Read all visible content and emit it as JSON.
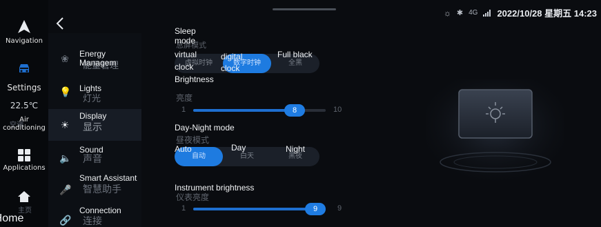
{
  "status_bar": {
    "bluetooth_icon": "bluetooth-icon",
    "signal": "4G",
    "datetime": "2022/10/28 星期五 14:23"
  },
  "rail": {
    "navigation": {
      "label": "Navigation",
      "icon": "navigation-arrow-icon"
    },
    "settings": {
      "label": "Settings",
      "icon": "car-settings-icon"
    },
    "temperature": "22.5℃",
    "climate": {
      "label": "Air conditioning",
      "zh": "空调"
    },
    "applications": {
      "label": "Applications",
      "icon": "apps-grid-icon"
    },
    "home": {
      "label": "Home",
      "zh": "主页",
      "icon": "home-icon"
    }
  },
  "menu": {
    "items": [
      {
        "en": "Energy Managem",
        "zh": "能量管理",
        "icon": "energy-leaf-icon"
      },
      {
        "en": "Lights",
        "zh": "灯光",
        "icon": "light-bulb-icon"
      },
      {
        "en": "Display",
        "zh": "显示",
        "icon": "brightness-sun-icon"
      },
      {
        "en": "Sound",
        "zh": "声音",
        "icon": "speaker-icon"
      },
      {
        "en": "Smart Assistant",
        "zh": "智慧助手",
        "icon": "microphone-icon"
      },
      {
        "en": "Connection",
        "zh": "连接",
        "icon": "link-icon"
      }
    ],
    "active": "Display"
  },
  "sleep_mode": {
    "en_1": "Sleep",
    "en_2": "mode",
    "zh": "息屏模式",
    "options": [
      {
        "en_1": "virtual",
        "en_2": "clock",
        "zh": "虚拟时钟"
      },
      {
        "en_1": "digital",
        "en_2": "clock",
        "zh": "数字时钟"
      },
      {
        "en": "Full black",
        "zh": "全黑"
      }
    ],
    "selected": "digital clock"
  },
  "brightness": {
    "en": "Brightness",
    "zh": "亮度",
    "min": "1",
    "max": "10",
    "value": "8"
  },
  "day_night": {
    "en": "Day-Night mode",
    "zh": "昼夜模式",
    "options": [
      {
        "en": "Auto",
        "zh": "自动"
      },
      {
        "en": "Day",
        "zh": "白天"
      },
      {
        "en": "Night",
        "zh": "黑夜"
      }
    ],
    "selected": "Auto"
  },
  "instrument": {
    "en": "Instrument brightness",
    "zh": "仪表亮度",
    "min": "1",
    "max": "9",
    "value": "9"
  },
  "colors": {
    "accent": "#1e7be0",
    "panel": "#0c0f14",
    "active_row": "#171c25"
  }
}
